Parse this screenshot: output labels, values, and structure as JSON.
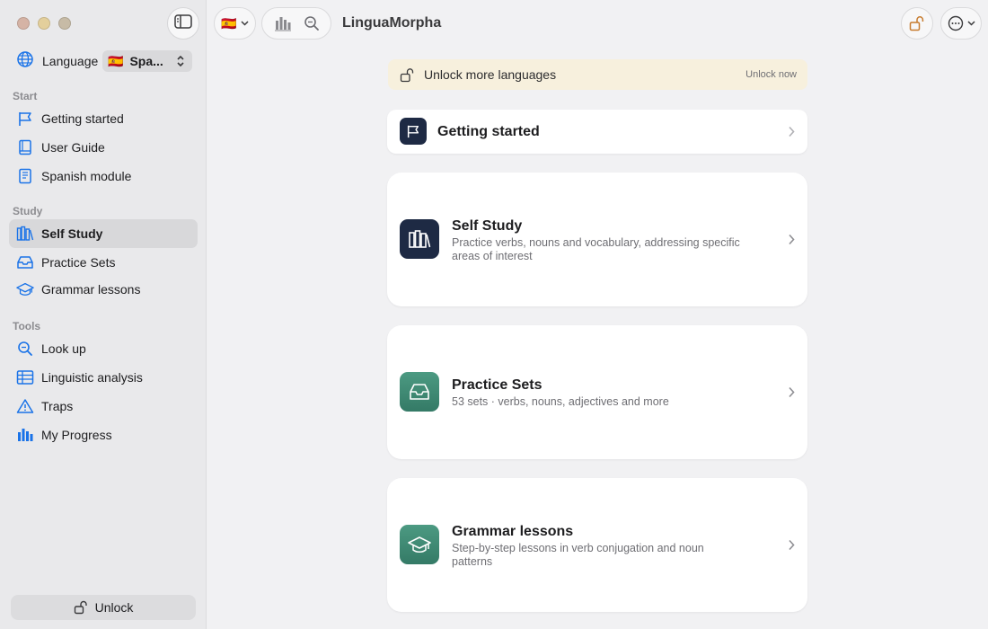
{
  "app": {
    "title": "LinguaMorpha"
  },
  "sidebar": {
    "language_label": "Language",
    "language_value": "Spa...",
    "language_flag": "🇪🇸",
    "sections": {
      "start": "Start",
      "study": "Study",
      "tools": "Tools"
    },
    "items": {
      "getting_started": "Getting started",
      "user_guide": "User Guide",
      "spanish_module": "Spanish module",
      "self_study": "Self Study",
      "practice_sets": "Practice Sets",
      "grammar_lessons": "Grammar lessons",
      "look_up": "Look up",
      "linguistic_analysis": "Linguistic analysis",
      "traps": "Traps",
      "my_progress": "My Progress"
    },
    "unlock_label": "Unlock"
  },
  "toolbar": {
    "flag": "🇪🇸"
  },
  "main": {
    "banner": {
      "text": "Unlock more languages",
      "action": "Unlock now"
    },
    "cards": {
      "getting_started": {
        "title": "Getting started"
      },
      "self_study": {
        "title": "Self Study",
        "desc": "Practice verbs, nouns and vocabulary, addressing specific areas of interest"
      },
      "practice_sets": {
        "title": "Practice Sets",
        "desc": "53 sets · verbs, nouns, adjectives and more"
      },
      "grammar_lessons": {
        "title": "Grammar lessons",
        "desc": "Step-by-step lessons in verb conjugation and noun patterns"
      }
    }
  },
  "colors": {
    "accent": "#1a73e8",
    "tile_dark": "#1e2a44",
    "tile_green": "#3e8e76",
    "banner_bg": "#f7f0dd"
  }
}
